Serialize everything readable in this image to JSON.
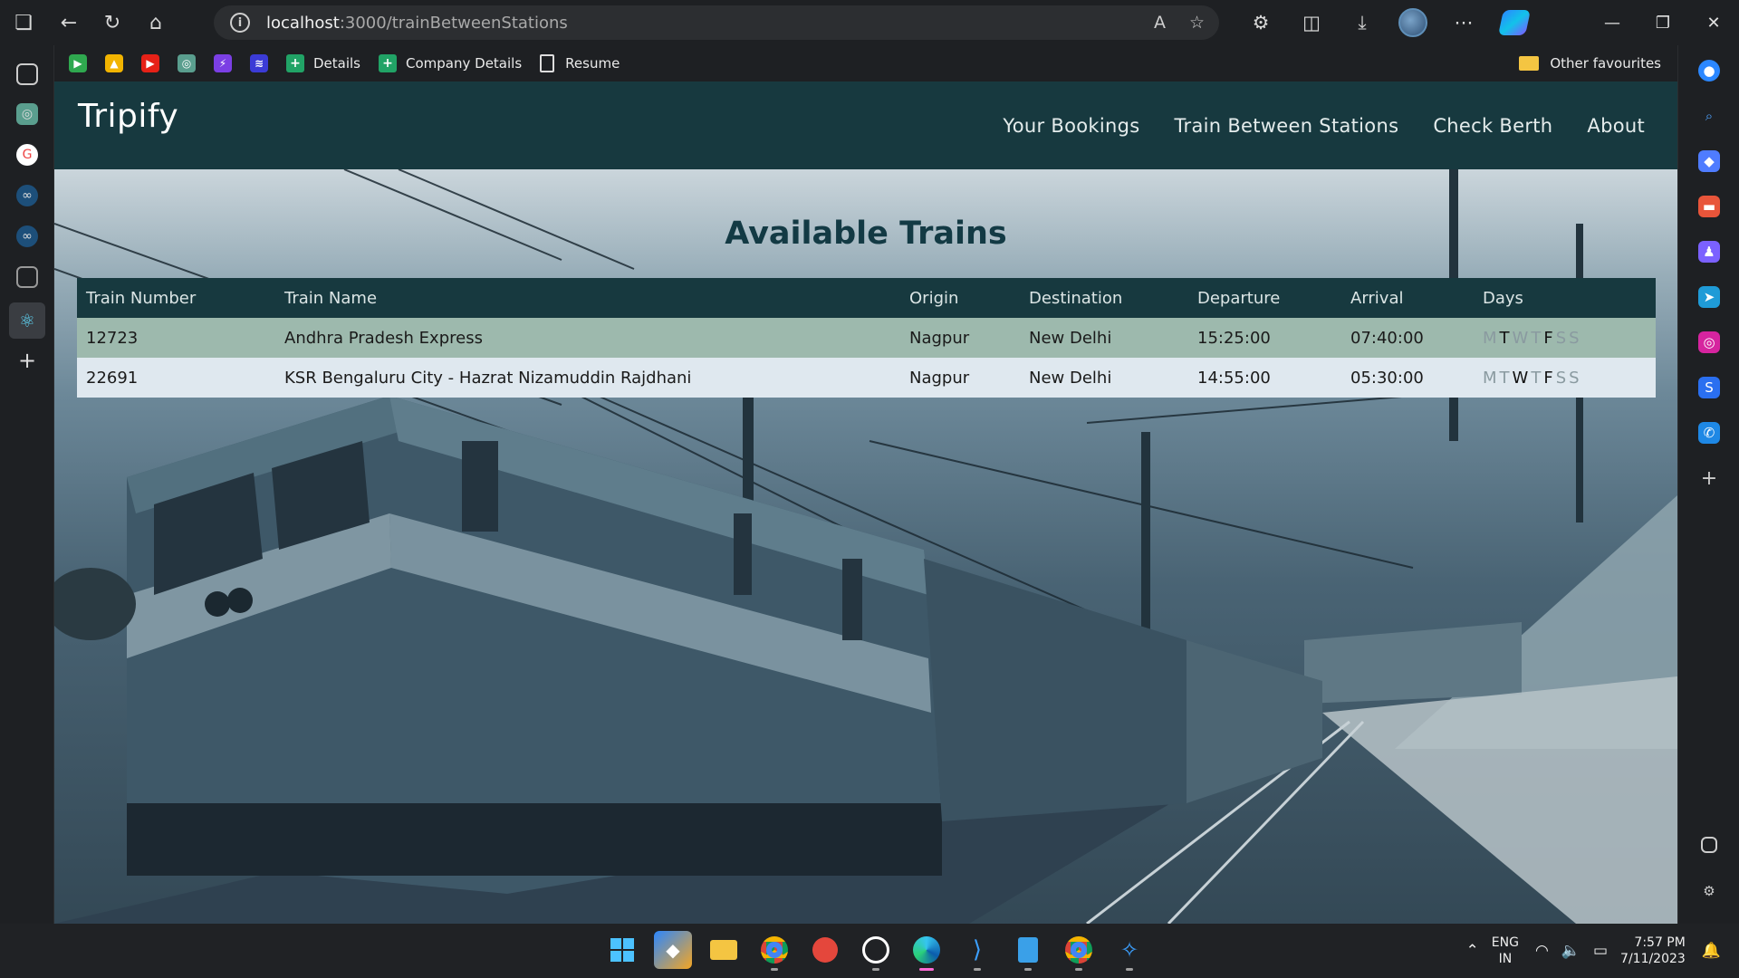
{
  "browser": {
    "url_host": "localhost",
    "url_path": ":3000/trainBetweenStations",
    "favorites": [
      {
        "label": "Details"
      },
      {
        "label": "Company Details"
      },
      {
        "label": "Resume"
      }
    ],
    "other_favourites": "Other favourites"
  },
  "site": {
    "brand": "Tripify",
    "nav": [
      {
        "label": "Your Bookings"
      },
      {
        "label": "Train Between Stations"
      },
      {
        "label": "Check Berth"
      },
      {
        "label": "About"
      }
    ]
  },
  "main": {
    "heading": "Available Trains",
    "table": {
      "columns": [
        "Train Number",
        "Train Name",
        "Origin",
        "Destination",
        "Departure",
        "Arrival",
        "Days"
      ],
      "rows": [
        {
          "number": "12723",
          "name": "Andhra Pradesh Express",
          "origin": "Nagpur",
          "destination": "New Delhi",
          "departure": "15:25:00",
          "arrival": "07:40:00",
          "days": [
            {
              "d": "M",
              "on": false
            },
            {
              "d": "T",
              "on": true
            },
            {
              "d": "W",
              "on": false
            },
            {
              "d": "T",
              "on": false
            },
            {
              "d": "F",
              "on": true
            },
            {
              "d": "S",
              "on": false
            },
            {
              "d": "S",
              "on": false
            }
          ]
        },
        {
          "number": "22691",
          "name": "KSR Bengaluru City - Hazrat Nizamuddin Rajdhani",
          "origin": "Nagpur",
          "destination": "New Delhi",
          "departure": "14:55:00",
          "arrival": "05:30:00",
          "days": [
            {
              "d": "M",
              "on": false
            },
            {
              "d": "T",
              "on": false
            },
            {
              "d": "W",
              "on": true
            },
            {
              "d": "T",
              "on": false
            },
            {
              "d": "F",
              "on": true
            },
            {
              "d": "S",
              "on": false
            },
            {
              "d": "S",
              "on": false
            }
          ]
        }
      ]
    }
  },
  "taskbar": {
    "lang_top": "ENG",
    "lang_bottom": "IN",
    "time": "7:57 PM",
    "date": "7/11/2023"
  },
  "colors": {
    "navbar": "#17393f",
    "row_odd": "#9db9ad",
    "row_even": "#dfe8ef",
    "heading": "#133a44"
  }
}
